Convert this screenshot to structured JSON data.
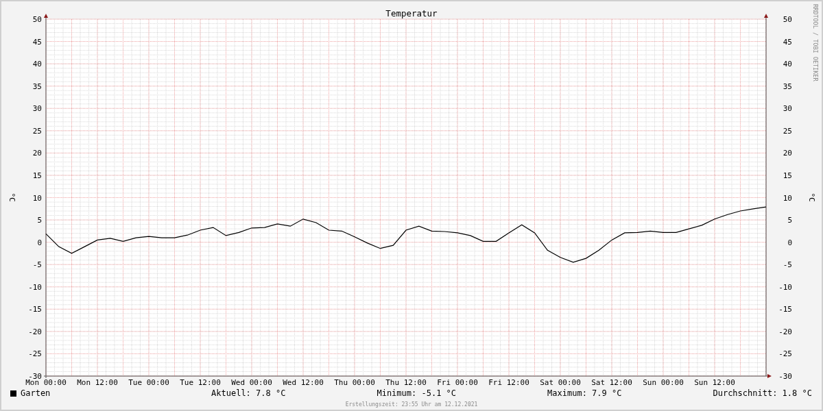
{
  "watermark": "RRDTOOL / TOBI OETIKER",
  "chart_data": {
    "type": "line",
    "title": "Temperatur",
    "ylabel": "°C",
    "ylim": [
      -30,
      50
    ],
    "grid": true,
    "categories": [
      "Mon 00:00",
      null,
      null,
      null,
      "Mon 12:00",
      null,
      null,
      null,
      "Tue 00:00",
      null,
      null,
      null,
      "Tue 12:00",
      null,
      null,
      null,
      "Wed 00:00",
      null,
      null,
      null,
      "Wed 12:00",
      null,
      null,
      null,
      "Thu 00:00",
      null,
      null,
      null,
      "Thu 12:00",
      null,
      null,
      null,
      "Fri 00:00",
      null,
      null,
      null,
      "Fri 12:00",
      null,
      null,
      null,
      "Sat 00:00",
      null,
      null,
      null,
      "Sat 12:00",
      null,
      null,
      null,
      "Sun 00:00",
      null,
      null,
      null,
      "Sun 12:00",
      null,
      null,
      null,
      null
    ],
    "series": [
      {
        "name": "Garten",
        "color": "#000000",
        "values": [
          1.9,
          -1.0,
          -2.5,
          -1.0,
          0.5,
          0.9,
          0.2,
          1.0,
          1.3,
          1.0,
          1.0,
          1.6,
          2.7,
          3.3,
          1.5,
          2.2,
          3.2,
          3.3,
          4.1,
          3.6,
          5.2,
          4.4,
          2.7,
          2.5,
          1.2,
          -0.2,
          -1.4,
          -0.7,
          2.7,
          3.6,
          2.5,
          2.4,
          2.1,
          1.5,
          0.2,
          0.2,
          2.1,
          3.9,
          2.1,
          -1.8,
          -3.4,
          -4.5,
          -3.6,
          -1.8,
          0.5,
          2.1,
          2.2,
          2.5,
          2.2,
          2.2,
          3.0,
          3.8,
          5.2,
          6.2,
          7.0,
          7.5,
          7.9
        ]
      }
    ],
    "yticks": [
      50,
      45,
      40,
      35,
      30,
      25,
      20,
      15,
      10,
      5,
      0,
      -5,
      -10,
      -15,
      -20,
      -25,
      -30
    ]
  },
  "right_axis": {
    "label": "°C",
    "ticks": [
      "50",
      "45",
      "40",
      "35",
      "30",
      "25",
      "20",
      "15",
      "10",
      "5",
      "0",
      "-5",
      "-10",
      "-15",
      "-20",
      "-25",
      "-30"
    ]
  },
  "legend": {
    "stats": [
      "Aktuell: 7.8 °C",
      "Minimum: -5.1 °C",
      "Maximum: 7.9 °C",
      "Durchschnitt: 1.8 °C"
    ]
  },
  "footer": "Erstellungszeit: 23:55 Uhr am 12.12.2021"
}
